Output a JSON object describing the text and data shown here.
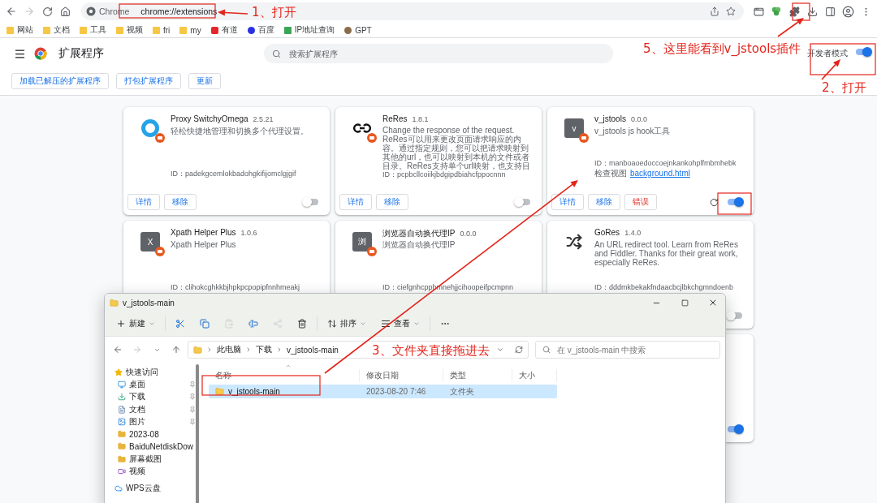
{
  "browser": {
    "omnibox": {
      "chip": "Chrome",
      "url": "chrome://extensions"
    },
    "bookmarks": [
      {
        "label": "网站",
        "kind": "folder"
      },
      {
        "label": "文档",
        "kind": "folder"
      },
      {
        "label": "工具",
        "kind": "folder"
      },
      {
        "label": "视频",
        "kind": "folder"
      },
      {
        "label": "fri",
        "kind": "folder"
      },
      {
        "label": "my",
        "kind": "folder"
      },
      {
        "label": "有道",
        "kind": "red"
      },
      {
        "label": "百度",
        "kind": "paw"
      },
      {
        "label": "IP地址查询",
        "kind": "tiles"
      },
      {
        "label": "GPT",
        "kind": "avatar"
      }
    ]
  },
  "header": {
    "title": "扩展程序",
    "search": {
      "placeholder": "搜索扩展程序"
    },
    "dev_mode": {
      "label": "开发者模式",
      "on": true
    }
  },
  "actions": [
    "加载已解压的扩展程序",
    "打包扩展程序",
    "更新"
  ],
  "extensions": [
    {
      "name": "Proxy SwitchyOmega",
      "version": "2.5.21",
      "kind": "ring",
      "badge": true,
      "description": "轻松快捷地管理和切换多个代理设置。",
      "id": "ID：padekgcemlokbadohgkifijomclgjgif",
      "buttons": [
        {
          "label": "详情",
          "kind": "normal"
        },
        {
          "label": "移除",
          "kind": "normal"
        }
      ],
      "enabled": false
    },
    {
      "name": "ReRes",
      "version": "1.8.1",
      "kind": "loop",
      "badge": true,
      "description": "Change the response of the request. ReRes可以用来更改页面请求响应的内容。通过指定规则，您可以把请求映射到其他的url，也可以映射到本机的文件或者目录。ReRes支持单个url映射，也支持目",
      "id": "ID：pcpbcllcoiikjbdgipdbiahcfppocnnn",
      "buttons": [
        {
          "label": "详情",
          "kind": "normal"
        },
        {
          "label": "移除",
          "kind": "normal"
        }
      ],
      "enabled": false
    },
    {
      "name": "v_jstools",
      "version": "0.0.0",
      "kind": "letter",
      "icon_letter": "v",
      "badge": true,
      "description": "v_jstools js hook工具",
      "id": "ID：manboaoedoccoejnkankohplfmbmhebk",
      "inspect": {
        "label": "检查视图",
        "link": "background.html"
      },
      "buttons": [
        {
          "label": "详情",
          "kind": "normal"
        },
        {
          "label": "移除",
          "kind": "normal"
        },
        {
          "label": "错误",
          "kind": "error"
        }
      ],
      "reload": true,
      "enabled": true
    },
    {
      "name": "Xpath Helper Plus",
      "version": "1.0.6",
      "kind": "letter",
      "icon_letter": "X",
      "badge": true,
      "description": "Xpath Helper Plus",
      "id": "ID：clihokcghkkbjhpkpcpopipfnnhmeakj"
    },
    {
      "name": "浏览器自动换代理IP",
      "version": "0.0.0",
      "kind": "letter",
      "icon_letter": "浏",
      "badge": true,
      "description": "浏览器自动换代理IP",
      "id": "ID：ciefgnhcpphmnehjjcihoopeifpcmpnn"
    },
    {
      "name": "GoRes",
      "version": "1.4.0",
      "kind": "shuffle",
      "badge": false,
      "description": "An URL redirect tool. Learn from ReRes and Fiddler. Thanks for their great work, especially ReRes.",
      "id": "ID：dddmkbekakfndaacbcjlbkchgmndoenb",
      "enabled": false
    },
    {
      "enabled": true
    }
  ],
  "explorer": {
    "title": "v_jstools-main",
    "commands": [
      {
        "kind": "new",
        "label": "新建",
        "disabled": false
      },
      {
        "kind": "cut",
        "disabled": false
      },
      {
        "kind": "copy",
        "disabled": false
      },
      {
        "kind": "paste",
        "disabled": true
      },
      {
        "kind": "rename",
        "disabled": false
      },
      {
        "kind": "share",
        "disabled": true
      },
      {
        "kind": "delete",
        "disabled": false
      },
      {
        "kind": "sort",
        "label": "排序",
        "disabled": false
      },
      {
        "kind": "view",
        "label": "查看",
        "disabled": false
      },
      {
        "kind": "more",
        "disabled": false
      }
    ],
    "breadcrumb": [
      "此电脑",
      "下载",
      "v_jstools-main"
    ],
    "search": {
      "placeholder": "在 v_jstools-main 中搜索"
    },
    "nav": [
      {
        "label": "快速访问",
        "kind": "star",
        "pinned": false,
        "children": [
          {
            "label": "桌面",
            "kind": "desktop",
            "pinned": true
          },
          {
            "label": "下载",
            "kind": "download",
            "pinned": true
          },
          {
            "label": "文档",
            "kind": "document",
            "pinned": true
          },
          {
            "label": "图片",
            "kind": "picture",
            "pinned": true
          },
          {
            "label": "2023-08",
            "kind": "folder",
            "pinned": false
          },
          {
            "label": "BaiduNetdiskDow",
            "kind": "folder",
            "pinned": false
          },
          {
            "label": "屏幕截图",
            "kind": "folder",
            "pinned": false
          },
          {
            "label": "视频",
            "kind": "video",
            "pinned": false
          }
        ]
      },
      {
        "label": "WPS云盘",
        "kind": "cloud",
        "pinned": false
      }
    ],
    "columns": [
      "名称",
      "修改日期",
      "类型",
      "大小"
    ],
    "files": [
      {
        "name": "v_jstools-main",
        "modified": "2023-08-20 7:46",
        "type": "文件夹",
        "selected": true
      }
    ]
  },
  "annotations": [
    "1、打开",
    "2、打开",
    "3、文件夹直接拖进去",
    "5、这里能看到v_jstools插件"
  ]
}
